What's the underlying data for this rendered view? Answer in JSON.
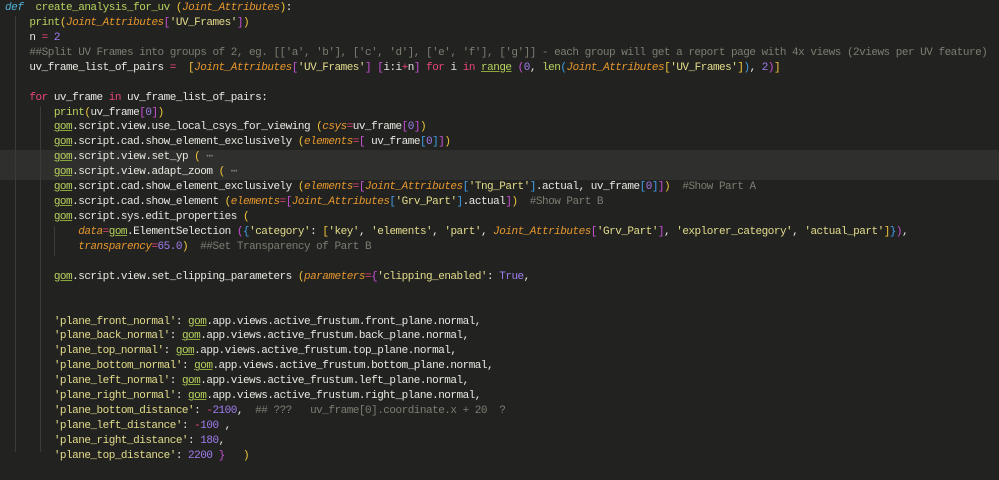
{
  "editor": {
    "highlighted_lines": [
      10,
      11
    ],
    "lines": [
      [
        [
          "kw",
          "def"
        ],
        [
          "",
          "  "
        ],
        [
          "fn",
          "create_analysis_for_uv"
        ],
        [
          "",
          " "
        ],
        [
          "b1",
          "("
        ],
        [
          "pa",
          "Joint_Attributes"
        ],
        [
          "b1",
          ")"
        ],
        [
          "",
          ":"
        ]
      ],
      [
        [
          "",
          "    "
        ],
        [
          "fn",
          "print"
        ],
        [
          "b1",
          "("
        ],
        [
          "pa",
          "Joint_Attributes"
        ],
        [
          "b2",
          "["
        ],
        [
          "st",
          "'UV_Frames'"
        ],
        [
          "b2",
          "]"
        ],
        [
          "b1",
          ")"
        ]
      ],
      [
        [
          "",
          "    n "
        ],
        [
          "op",
          "="
        ],
        [
          "",
          " "
        ],
        [
          "nu",
          "2"
        ]
      ],
      [
        [
          "",
          "    "
        ],
        [
          "cm",
          "##Split UV Frames into groups of 2, eg. [['a', 'b'], ['c', 'd'], ['e', 'f'], ['g']] - each group will get a report page with 4x views (2views per UV feature)"
        ]
      ],
      [
        [
          "",
          "    uv_frame_list_of_pairs "
        ],
        [
          "op",
          "="
        ],
        [
          "",
          "  "
        ],
        [
          "b1",
          "["
        ],
        [
          "pa",
          "Joint_Attributes"
        ],
        [
          "b2",
          "["
        ],
        [
          "st",
          "'UV_Frames'"
        ],
        [
          "b2",
          "]"
        ],
        [
          "",
          " "
        ],
        [
          "b2",
          "["
        ],
        [
          "",
          "i:i"
        ],
        [
          "op",
          "+"
        ],
        [
          "",
          "n"
        ],
        [
          "b2",
          "]"
        ],
        [
          "",
          " "
        ],
        [
          "ctl",
          "for"
        ],
        [
          "",
          " i "
        ],
        [
          "ctl",
          "in"
        ],
        [
          "",
          " "
        ],
        [
          "bi",
          "range"
        ],
        [
          "",
          " "
        ],
        [
          "b2",
          "("
        ],
        [
          "nu",
          "0"
        ],
        [
          "",
          ", "
        ],
        [
          "fn",
          "len"
        ],
        [
          "b3",
          "("
        ],
        [
          "pa",
          "Joint_Attributes"
        ],
        [
          "b1",
          "["
        ],
        [
          "st",
          "'UV_Frames'"
        ],
        [
          "b1",
          "]"
        ],
        [
          "b3",
          ")"
        ],
        [
          "",
          ", "
        ],
        [
          "nu",
          "2"
        ],
        [
          "b2",
          ")"
        ],
        [
          "b1",
          "]"
        ]
      ],
      [],
      [
        [
          "",
          "    "
        ],
        [
          "ctl",
          "for"
        ],
        [
          "",
          " uv_frame "
        ],
        [
          "ctl",
          "in"
        ],
        [
          "",
          " uv_frame_list_of_pairs:"
        ]
      ],
      [
        [
          "",
          "        "
        ],
        [
          "fn",
          "print"
        ],
        [
          "b1",
          "("
        ],
        [
          "",
          "uv_frame"
        ],
        [
          "b2",
          "["
        ],
        [
          "nu",
          "0"
        ],
        [
          "b2",
          "]"
        ],
        [
          "b1",
          ")"
        ]
      ],
      [
        [
          "",
          "        "
        ],
        [
          "gm",
          "gom"
        ],
        [
          "",
          ".script.view.use_local_csys_for_viewing "
        ],
        [
          "b1",
          "("
        ],
        [
          "pa",
          "csys"
        ],
        [
          "op",
          "="
        ],
        [
          "",
          "uv_frame"
        ],
        [
          "b2",
          "["
        ],
        [
          "nu",
          "0"
        ],
        [
          "b2",
          "]"
        ],
        [
          "b1",
          ")"
        ]
      ],
      [
        [
          "",
          "        "
        ],
        [
          "gm",
          "gom"
        ],
        [
          "",
          ".script.cad.show_element_exclusively "
        ],
        [
          "b1",
          "("
        ],
        [
          "pa",
          "elements"
        ],
        [
          "op",
          "="
        ],
        [
          "b2",
          "["
        ],
        [
          "",
          " uv_frame"
        ],
        [
          "b3",
          "["
        ],
        [
          "nu",
          "0"
        ],
        [
          "b3",
          "]"
        ],
        [
          "b2",
          "]"
        ],
        [
          "b1",
          ")"
        ]
      ],
      [
        [
          "",
          "        "
        ],
        [
          "gm",
          "gom"
        ],
        [
          "",
          ".script.view.set_yp "
        ],
        [
          "b1",
          "("
        ],
        [
          "el",
          " ⋯"
        ]
      ],
      [
        [
          "",
          "        "
        ],
        [
          "gm",
          "gom"
        ],
        [
          "",
          ".script.view.adapt_zoom "
        ],
        [
          "b1",
          "("
        ],
        [
          "el",
          " ⋯"
        ]
      ],
      [
        [
          "",
          "        "
        ],
        [
          "gm",
          "gom"
        ],
        [
          "",
          ".script.cad.show_element_exclusively "
        ],
        [
          "b1",
          "("
        ],
        [
          "pa",
          "elements"
        ],
        [
          "op",
          "="
        ],
        [
          "b2",
          "["
        ],
        [
          "pa",
          "Joint_Attributes"
        ],
        [
          "b3",
          "["
        ],
        [
          "st",
          "'Tng_Part'"
        ],
        [
          "b3",
          "]"
        ],
        [
          "",
          ".actual, uv_frame"
        ],
        [
          "b3",
          "["
        ],
        [
          "nu",
          "0"
        ],
        [
          "b3",
          "]"
        ],
        [
          "b2",
          "]"
        ],
        [
          "b1",
          ")"
        ],
        [
          "",
          "  "
        ],
        [
          "cm",
          "#Show Part A"
        ]
      ],
      [
        [
          "",
          "        "
        ],
        [
          "gm",
          "gom"
        ],
        [
          "",
          ".script.cad.show_element "
        ],
        [
          "b1",
          "("
        ],
        [
          "pa",
          "elements"
        ],
        [
          "op",
          "="
        ],
        [
          "b2",
          "["
        ],
        [
          "pa",
          "Joint_Attributes"
        ],
        [
          "b3",
          "["
        ],
        [
          "st",
          "'Grv_Part'"
        ],
        [
          "b3",
          "]"
        ],
        [
          "",
          ".actual"
        ],
        [
          "b2",
          "]"
        ],
        [
          "b1",
          ")"
        ],
        [
          "",
          "  "
        ],
        [
          "cm",
          "#Show Part B"
        ]
      ],
      [
        [
          "",
          "        "
        ],
        [
          "gm",
          "gom"
        ],
        [
          "",
          ".script.sys.edit_properties "
        ],
        [
          "b1",
          "("
        ]
      ],
      [
        [
          "",
          "            "
        ],
        [
          "pa",
          "data"
        ],
        [
          "op",
          "="
        ],
        [
          "gm",
          "gom"
        ],
        [
          "",
          ".ElementSelection "
        ],
        [
          "b2",
          "("
        ],
        [
          "b3",
          "{"
        ],
        [
          "st",
          "'category'"
        ],
        [
          "",
          ": "
        ],
        [
          "b1",
          "["
        ],
        [
          "st",
          "'key'"
        ],
        [
          "",
          ", "
        ],
        [
          "st",
          "'elements'"
        ],
        [
          "",
          ", "
        ],
        [
          "st",
          "'part'"
        ],
        [
          "",
          ", "
        ],
        [
          "pa",
          "Joint_Attributes"
        ],
        [
          "b2",
          "["
        ],
        [
          "st",
          "'Grv_Part'"
        ],
        [
          "b2",
          "]"
        ],
        [
          "",
          ", "
        ],
        [
          "st",
          "'explorer_category'"
        ],
        [
          "",
          ", "
        ],
        [
          "st",
          "'actual_part'"
        ],
        [
          "b1",
          "]"
        ],
        [
          "b3",
          "}"
        ],
        [
          "b2",
          ")"
        ],
        [
          "",
          ","
        ]
      ],
      [
        [
          "",
          "            "
        ],
        [
          "pa",
          "transparency"
        ],
        [
          "op",
          "="
        ],
        [
          "nu",
          "65.0"
        ],
        [
          "b1",
          ")"
        ],
        [
          "",
          "  "
        ],
        [
          "cm",
          "##Set Transparency of Part B"
        ]
      ],
      [],
      [
        [
          "",
          "        "
        ],
        [
          "gm",
          "gom"
        ],
        [
          "",
          ".script.view.set_clipping_parameters "
        ],
        [
          "b1",
          "("
        ],
        [
          "pa",
          "parameters"
        ],
        [
          "op",
          "="
        ],
        [
          "b2",
          "{"
        ],
        [
          "st",
          "'clipping_enabled'"
        ],
        [
          "",
          ": "
        ],
        [
          "nu",
          "True"
        ],
        [
          "",
          ","
        ]
      ],
      [],
      [],
      [
        [
          "",
          "        "
        ],
        [
          "st",
          "'plane_front_normal'"
        ],
        [
          "",
          ": "
        ],
        [
          "gm",
          "gom"
        ],
        [
          "",
          ".app.views.active_frustum.front_plane.normal,"
        ]
      ],
      [
        [
          "",
          "        "
        ],
        [
          "st",
          "'plane_back_normal'"
        ],
        [
          "",
          ": "
        ],
        [
          "gm",
          "gom"
        ],
        [
          "",
          ".app.views.active_frustum.back_plane.normal,"
        ]
      ],
      [
        [
          "",
          "        "
        ],
        [
          "st",
          "'plane_top_normal'"
        ],
        [
          "",
          ": "
        ],
        [
          "gm",
          "gom"
        ],
        [
          "",
          ".app.views.active_frustum.top_plane.normal,"
        ]
      ],
      [
        [
          "",
          "        "
        ],
        [
          "st",
          "'plane_bottom_normal'"
        ],
        [
          "",
          ": "
        ],
        [
          "gm",
          "gom"
        ],
        [
          "",
          ".app.views.active_frustum.bottom_plane.normal,"
        ]
      ],
      [
        [
          "",
          "        "
        ],
        [
          "st",
          "'plane_left_normal'"
        ],
        [
          "",
          ": "
        ],
        [
          "gm",
          "gom"
        ],
        [
          "",
          ".app.views.active_frustum.left_plane.normal,"
        ]
      ],
      [
        [
          "",
          "        "
        ],
        [
          "st",
          "'plane_right_normal'"
        ],
        [
          "",
          ": "
        ],
        [
          "gm",
          "gom"
        ],
        [
          "",
          ".app.views.active_frustum.right_plane.normal,"
        ]
      ],
      [
        [
          "",
          "        "
        ],
        [
          "st",
          "'plane_bottom_distance'"
        ],
        [
          "",
          ": "
        ],
        [
          "op",
          "-"
        ],
        [
          "nu",
          "2100"
        ],
        [
          "",
          ",  "
        ],
        [
          "cm",
          "## ???   uv_frame[0].coordinate.x + 20  ?"
        ]
      ],
      [
        [
          "",
          "        "
        ],
        [
          "st",
          "'plane_left_distance'"
        ],
        [
          "",
          ": "
        ],
        [
          "op",
          "-"
        ],
        [
          "nu",
          "100"
        ],
        [
          "",
          " ,"
        ]
      ],
      [
        [
          "",
          "        "
        ],
        [
          "st",
          "'plane_right_distance'"
        ],
        [
          "",
          ": "
        ],
        [
          "nu",
          "180"
        ],
        [
          "",
          ","
        ]
      ],
      [
        [
          "",
          "        "
        ],
        [
          "st",
          "'plane_top_distance'"
        ],
        [
          "",
          ": "
        ],
        [
          "nu",
          "2200"
        ],
        [
          "",
          " "
        ],
        [
          "b2",
          "}"
        ],
        [
          "",
          "   "
        ],
        [
          "b1",
          ")"
        ]
      ]
    ]
  }
}
